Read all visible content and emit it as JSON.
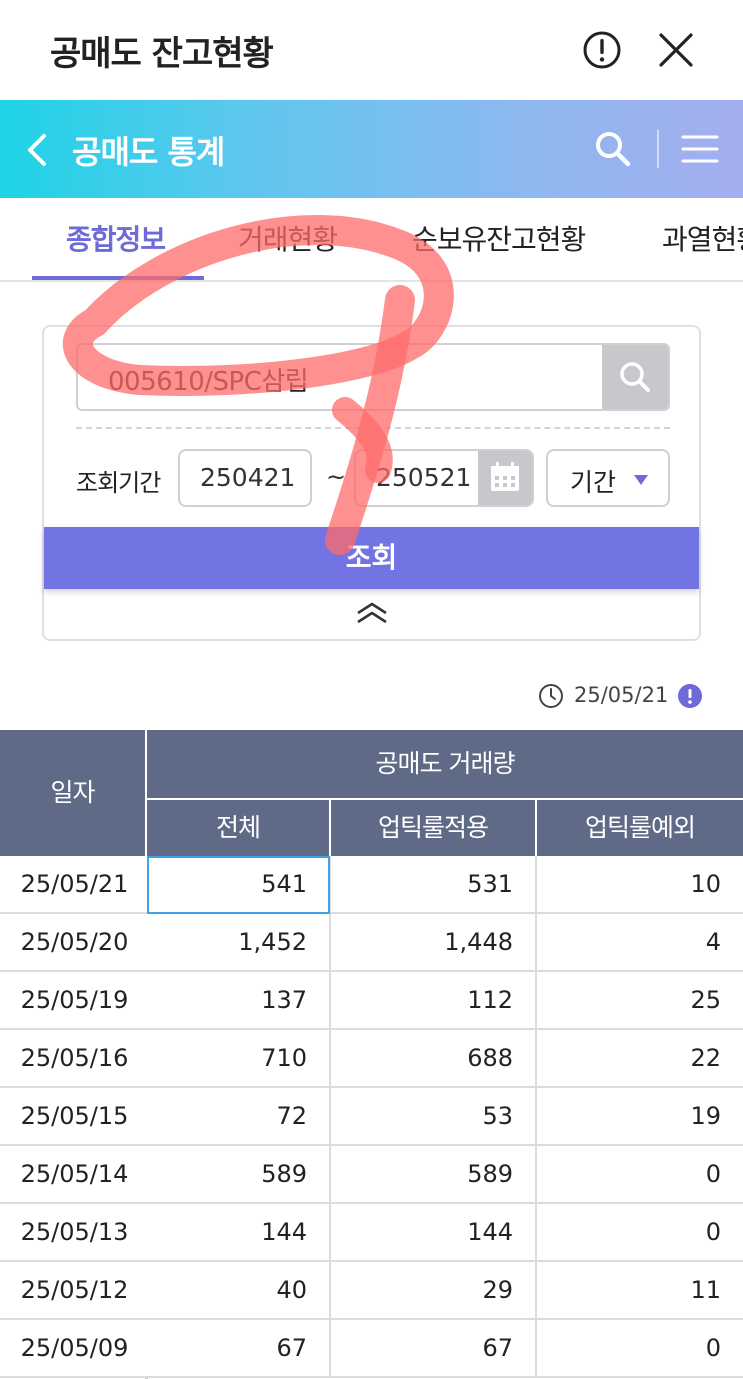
{
  "window": {
    "title": "공매도 잔고현황"
  },
  "nav": {
    "title": "공매도 통계"
  },
  "tabs": [
    {
      "label": "종합정보",
      "active": true
    },
    {
      "label": "거래현황",
      "active": false
    },
    {
      "label": "순보유잔고현황",
      "active": false
    },
    {
      "label": "과열현황",
      "active": false
    }
  ],
  "search": {
    "stock": "005610/SPC삼립",
    "period_label": "조회기간",
    "date_from": "250421",
    "tilde": "~",
    "date_to": "250521",
    "period_select": "기간",
    "query_button": "조회"
  },
  "timestamp": {
    "text": "25/05/21"
  },
  "table": {
    "col_date": "일자",
    "group_header": "공매도 거래량",
    "col_total": "전체",
    "col_apply": "업틱룰적용",
    "col_except": "업틱룰예외",
    "rows": [
      {
        "date": "25/05/21",
        "total": "541",
        "apply": "531",
        "except": "10"
      },
      {
        "date": "25/05/20",
        "total": "1,452",
        "apply": "1,448",
        "except": "4"
      },
      {
        "date": "25/05/19",
        "total": "137",
        "apply": "112",
        "except": "25"
      },
      {
        "date": "25/05/16",
        "total": "710",
        "apply": "688",
        "except": "22"
      },
      {
        "date": "25/05/15",
        "total": "72",
        "apply": "53",
        "except": "19"
      },
      {
        "date": "25/05/14",
        "total": "589",
        "apply": "589",
        "except": "0"
      },
      {
        "date": "25/05/13",
        "total": "144",
        "apply": "144",
        "except": "0"
      },
      {
        "date": "25/05/12",
        "total": "40",
        "apply": "29",
        "except": "11"
      },
      {
        "date": "25/05/09",
        "total": "67",
        "apply": "67",
        "except": "0"
      }
    ]
  },
  "colors": {
    "accent": "#7274e3",
    "tab_active": "#6e6bd8",
    "header_bg": "#5f6a87",
    "annotation": "#ff6b6b"
  }
}
